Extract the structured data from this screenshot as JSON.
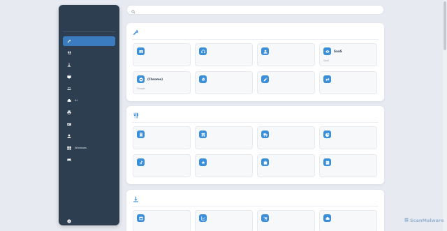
{
  "sidebar": {
    "title": "",
    "subtitle": "",
    "items": [
      {
        "label": "",
        "icon": "tools-icon",
        "active": true
      },
      {
        "label": "",
        "icon": "utensils-icon"
      },
      {
        "label": "",
        "icon": "download-icon"
      },
      {
        "label": "",
        "icon": "box-icon"
      },
      {
        "label": "",
        "icon": "laptop-icon"
      },
      {
        "label": "AI",
        "icon": "cloud-icon"
      },
      {
        "label": "",
        "icon": "printer-icon"
      },
      {
        "label": "",
        "icon": "id-card-icon"
      },
      {
        "label": "",
        "icon": "user-icon"
      },
      {
        "label": "Windows",
        "icon": "windows-icon"
      },
      {
        "label": "",
        "icon": "vr-headset-icon"
      }
    ],
    "footer": {
      "label": "",
      "icon": "info-icon"
    }
  },
  "search": {
    "placeholder": "",
    "icon": "search-icon"
  },
  "sections": [
    {
      "title": "",
      "icon": "tools-icon",
      "cards": [
        {
          "title": "",
          "desc": "",
          "icon": "image-icon"
        },
        {
          "title": "",
          "desc": "",
          "icon": "headset-icon"
        },
        {
          "title": "",
          "desc": "",
          "icon": "user-badge-icon"
        },
        {
          "title": "SaaS",
          "desc": "SaaS",
          "icon": "eye-icon"
        },
        {
          "title": "(Chrome)",
          "desc": "Google",
          "icon": "chrome-icon"
        },
        {
          "title": "",
          "desc": "",
          "icon": "gear-icon"
        },
        {
          "title": "",
          "desc": "",
          "icon": "edit-icon"
        },
        {
          "title": "",
          "desc": "",
          "icon": "exchange-icon"
        }
      ]
    },
    {
      "title": "",
      "icon": "utensils-icon",
      "cards": [
        {
          "title": "",
          "desc": "",
          "icon": "building-icon"
        },
        {
          "title": "",
          "desc": "",
          "icon": "shop-icon"
        },
        {
          "title": "",
          "desc": "",
          "icon": "truck-icon"
        },
        {
          "title": "",
          "desc": "",
          "icon": "pie-chart-icon"
        },
        {
          "title": "",
          "desc": "",
          "icon": "tiktok-icon"
        },
        {
          "title": "",
          "desc": "",
          "icon": "star-icon"
        },
        {
          "title": "",
          "desc": "",
          "icon": "bag-icon"
        },
        {
          "title": "",
          "desc": "",
          "icon": "calendar-icon"
        }
      ]
    },
    {
      "title": "",
      "icon": "download-icon",
      "cards": [
        {
          "title": "",
          "desc": "",
          "icon": "window-icon"
        },
        {
          "title": "",
          "desc": "",
          "icon": "line-chart-icon"
        },
        {
          "title": "",
          "desc": "",
          "icon": "cart-icon"
        },
        {
          "title": "",
          "desc": "",
          "icon": "cloud-icon"
        }
      ]
    }
  ],
  "watermark": {
    "text": "ScanMalware"
  },
  "colors": {
    "sidebar_bg": "#2c3e50",
    "accent": "#3b8fd9",
    "active_item": "#3b7bbf",
    "page_bg": "#e7eaf0"
  }
}
